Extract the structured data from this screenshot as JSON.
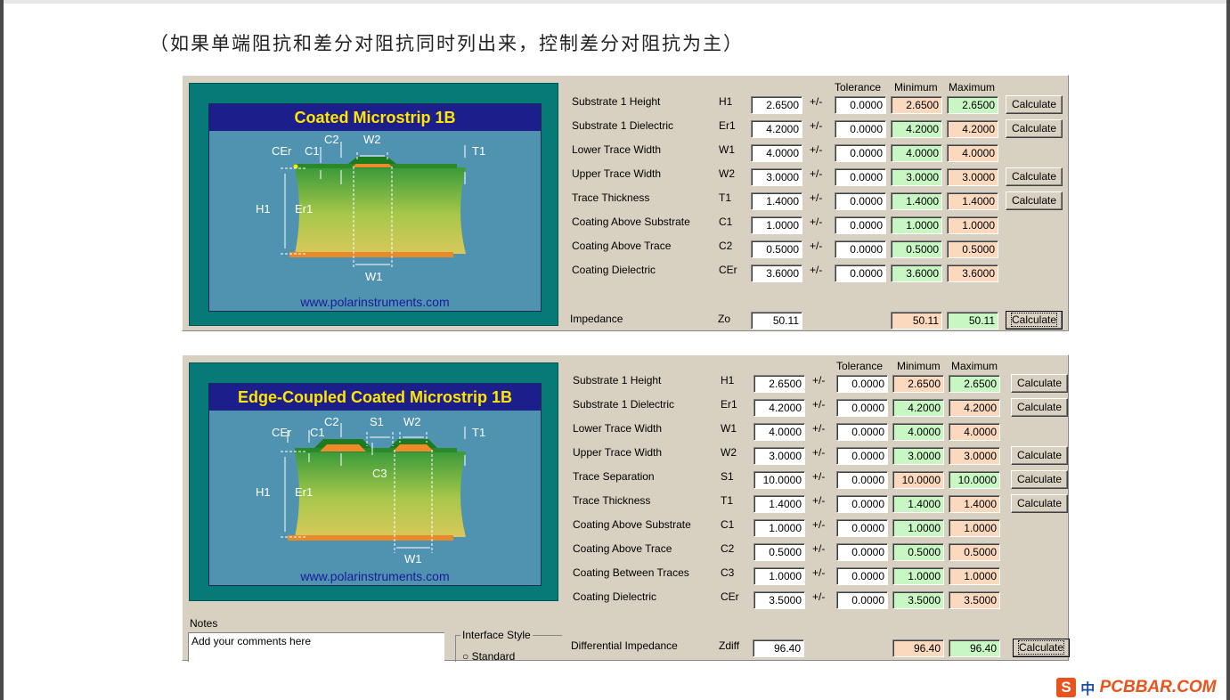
{
  "caption": "（如果单端阻抗和差分对阻抗同时列出来，控制差分对阻抗为主）",
  "column_headers": {
    "tolerance": "Tolerance",
    "minimum": "Minimum",
    "maximum": "Maximum"
  },
  "pm_symbol": "+/-",
  "calculate_label": "Calculate",
  "panel1": {
    "diagram_title": "Coated Microstrip 1B",
    "diagram_url": "www.polarinstruments.com",
    "diagram_labels": {
      "cer": "CEr",
      "c1": "C1",
      "c2": "C2",
      "w2": "W2",
      "t1": "T1",
      "h1": "H1",
      "er1": "Er1",
      "w1": "W1"
    },
    "rows": [
      {
        "label": "Substrate 1 Height",
        "sym": "H1",
        "value": "2.6500",
        "tol": "0.0000",
        "min": "2.6500",
        "max": "2.6500",
        "calc": true,
        "minColor": "orange"
      },
      {
        "label": "Substrate 1 Dielectric",
        "sym": "Er1",
        "value": "4.2000",
        "tol": "0.0000",
        "min": "4.2000",
        "max": "4.2000",
        "calc": true,
        "minColor": "green"
      },
      {
        "label": "Lower Trace Width",
        "sym": "W1",
        "value": "4.0000",
        "tol": "0.0000",
        "min": "4.0000",
        "max": "4.0000",
        "calc": false,
        "minColor": "green"
      },
      {
        "label": "Upper Trace Width",
        "sym": "W2",
        "value": "3.0000",
        "tol": "0.0000",
        "min": "3.0000",
        "max": "3.0000",
        "calc": true,
        "minColor": "green"
      },
      {
        "label": "Trace Thickness",
        "sym": "T1",
        "value": "1.4000",
        "tol": "0.0000",
        "min": "1.4000",
        "max": "1.4000",
        "calc": true,
        "minColor": "green"
      },
      {
        "label": "Coating Above Substrate",
        "sym": "C1",
        "value": "1.0000",
        "tol": "0.0000",
        "min": "1.0000",
        "max": "1.0000",
        "calc": false,
        "minColor": "green"
      },
      {
        "label": "Coating Above Trace",
        "sym": "C2",
        "value": "0.5000",
        "tol": "0.0000",
        "min": "0.5000",
        "max": "0.5000",
        "calc": false,
        "minColor": "green"
      },
      {
        "label": "Coating Dielectric",
        "sym": "CEr",
        "value": "3.6000",
        "tol": "0.0000",
        "min": "3.6000",
        "max": "3.6000",
        "calc": false,
        "minColor": "green"
      }
    ],
    "result": {
      "label": "Impedance",
      "sym": "Zo",
      "value": "50.11",
      "min": "50.11",
      "max": "50.11"
    }
  },
  "panel2": {
    "diagram_title": "Edge-Coupled Coated Microstrip 1B",
    "diagram_url": "www.polarinstruments.com",
    "diagram_labels": {
      "cer": "CEr",
      "c1": "C1",
      "c2": "C2",
      "s1": "S1",
      "w2": "W2",
      "t1": "T1",
      "c3": "C3",
      "h1": "H1",
      "er1": "Er1",
      "w1": "W1"
    },
    "rows": [
      {
        "label": "Substrate 1 Height",
        "sym": "H1",
        "value": "2.6500",
        "tol": "0.0000",
        "min": "2.6500",
        "max": "2.6500",
        "calc": true,
        "minColor": "orange"
      },
      {
        "label": "Substrate 1 Dielectric",
        "sym": "Er1",
        "value": "4.2000",
        "tol": "0.0000",
        "min": "4.2000",
        "max": "4.2000",
        "calc": true,
        "minColor": "green"
      },
      {
        "label": "Lower Trace Width",
        "sym": "W1",
        "value": "4.0000",
        "tol": "0.0000",
        "min": "4.0000",
        "max": "4.0000",
        "calc": false,
        "minColor": "green"
      },
      {
        "label": "Upper Trace Width",
        "sym": "W2",
        "value": "3.0000",
        "tol": "0.0000",
        "min": "3.0000",
        "max": "3.0000",
        "calc": true,
        "minColor": "green"
      },
      {
        "label": "Trace Separation",
        "sym": "S1",
        "value": "10.0000",
        "tol": "0.0000",
        "min": "10.0000",
        "max": "10.0000",
        "calc": true,
        "minColor": "orange"
      },
      {
        "label": "Trace Thickness",
        "sym": "T1",
        "value": "1.4000",
        "tol": "0.0000",
        "min": "1.4000",
        "max": "1.4000",
        "calc": true,
        "minColor": "green"
      },
      {
        "label": "Coating Above Substrate",
        "sym": "C1",
        "value": "1.0000",
        "tol": "0.0000",
        "min": "1.0000",
        "max": "1.0000",
        "calc": false,
        "minColor": "green"
      },
      {
        "label": "Coating Above Trace",
        "sym": "C2",
        "value": "0.5000",
        "tol": "0.0000",
        "min": "0.5000",
        "max": "0.5000",
        "calc": false,
        "minColor": "green"
      },
      {
        "label": "Coating Between Traces",
        "sym": "C3",
        "value": "1.0000",
        "tol": "0.0000",
        "min": "1.0000",
        "max": "1.0000",
        "calc": false,
        "minColor": "green"
      },
      {
        "label": "Coating Dielectric",
        "sym": "CEr",
        "value": "3.5000",
        "tol": "0.0000",
        "min": "3.5000",
        "max": "3.5000",
        "calc": false,
        "minColor": "green"
      }
    ],
    "result": {
      "label": "Differential Impedance",
      "sym": "Zdiff",
      "value": "96.40",
      "min": "96.40",
      "max": "96.40"
    },
    "notes_label": "Notes",
    "notes_value": "Add your comments here",
    "interface_style_label": "Interface Style",
    "interface_style_option": "Standard"
  },
  "watermark": {
    "icon": "S",
    "cn": "中",
    "text": "PCBBAR.COM"
  },
  "colors": {
    "panel_bg": "#d8d0c0",
    "min_orange": "#fbd9bf",
    "max_green": "#c8f7c4",
    "diagram_title_bg": "#1c1f8b",
    "diagram_title_fg": "#ffe600",
    "diagram_frame": "#077a78"
  }
}
